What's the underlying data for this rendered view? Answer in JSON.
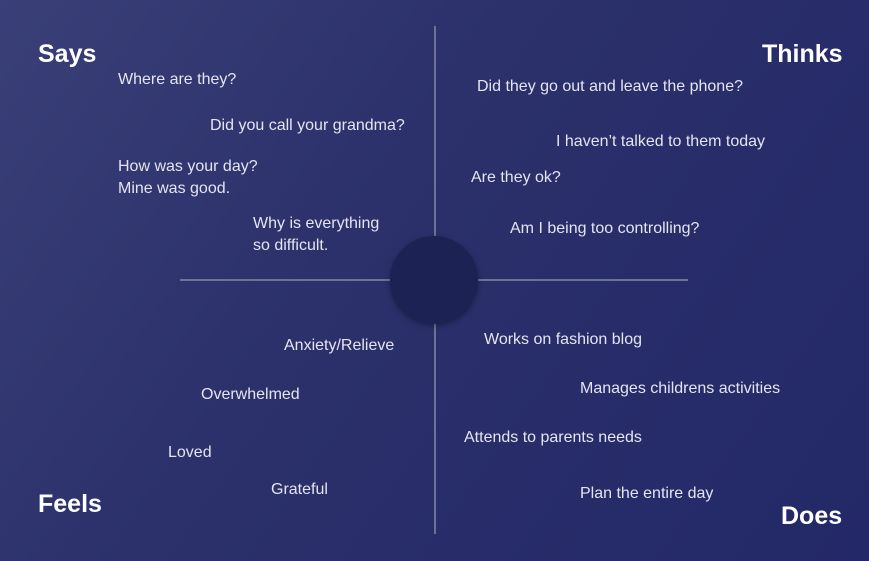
{
  "quadrants": {
    "says": {
      "title": "Says",
      "items": [
        "Where are they?",
        "Did you call your grandma?",
        "How was your day?\nMine was good.",
        "Why is everything\nso difficult."
      ]
    },
    "thinks": {
      "title": "Thinks",
      "items": [
        "Did they go out and leave the phone?",
        "I haven’t talked to them today",
        "Are they ok?",
        "Am I being too controlling?"
      ]
    },
    "feels": {
      "title": "Feels",
      "items": [
        "Anxiety/Relieve",
        "Overwhelmed",
        "Loved",
        "Grateful"
      ]
    },
    "does": {
      "title": "Does",
      "items": [
        "Works on fashion blog",
        "Manages childrens activities",
        "Attends to parents needs",
        "Plan the entire day"
      ]
    }
  },
  "colors": {
    "background": "#2c316b",
    "divider": "#6e7294",
    "center_circle": "#1d2255",
    "heading_text": "#ffffff",
    "item_text": "#e4e5f0"
  }
}
